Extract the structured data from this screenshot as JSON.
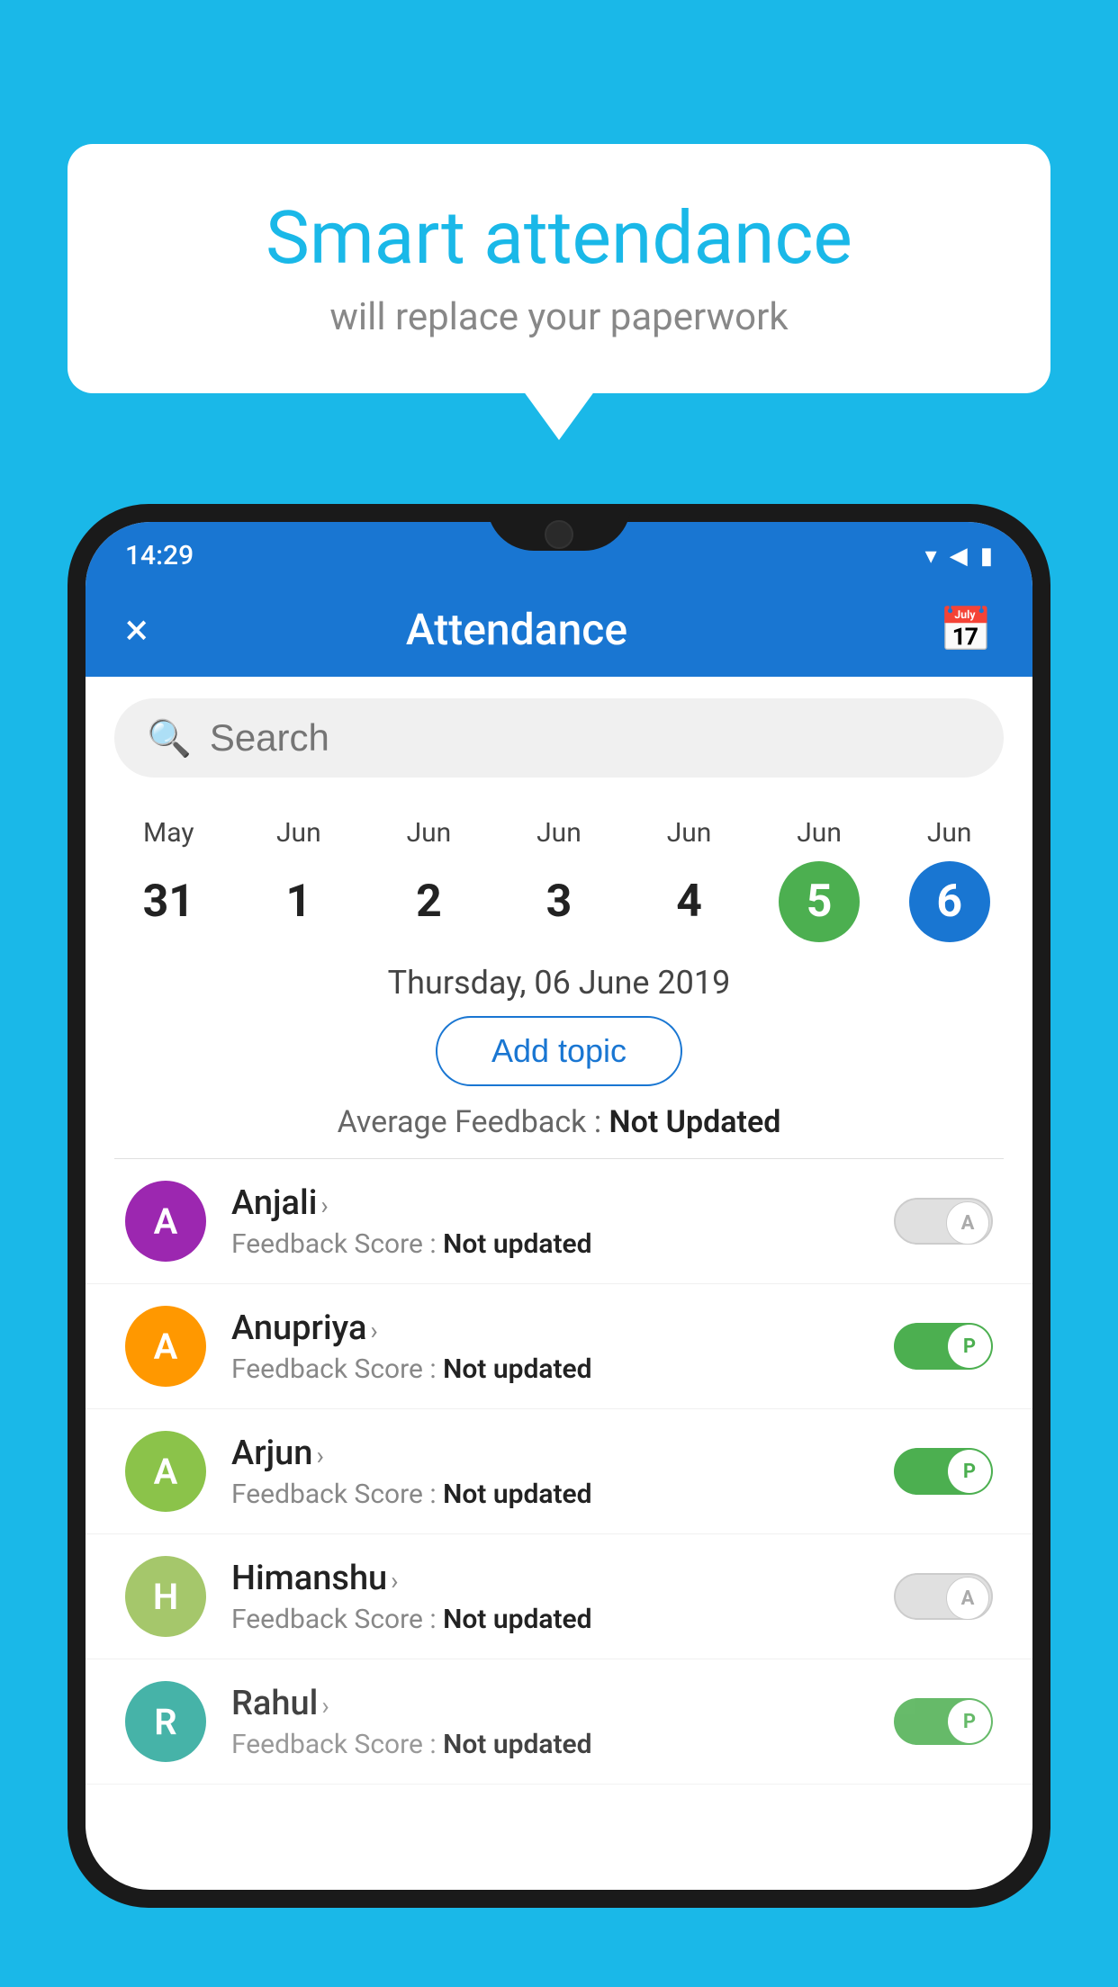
{
  "background_color": "#1ab8e8",
  "speech_bubble": {
    "title": "Smart attendance",
    "subtitle": "will replace your paperwork"
  },
  "status_bar": {
    "time": "14:29",
    "icons": [
      "wifi",
      "signal",
      "battery"
    ]
  },
  "app_bar": {
    "title": "Attendance",
    "close_label": "×",
    "calendar_icon": "📅"
  },
  "search": {
    "placeholder": "Search"
  },
  "calendar": {
    "days": [
      {
        "month": "May",
        "date": "31",
        "state": "normal"
      },
      {
        "month": "Jun",
        "date": "1",
        "state": "normal"
      },
      {
        "month": "Jun",
        "date": "2",
        "state": "normal"
      },
      {
        "month": "Jun",
        "date": "3",
        "state": "normal"
      },
      {
        "month": "Jun",
        "date": "4",
        "state": "normal"
      },
      {
        "month": "Jun",
        "date": "5",
        "state": "today"
      },
      {
        "month": "Jun",
        "date": "6",
        "state": "selected"
      }
    ]
  },
  "selected_date_label": "Thursday, 06 June 2019",
  "add_topic_label": "Add topic",
  "average_feedback_prefix": "Average Feedback : ",
  "average_feedback_value": "Not Updated",
  "students": [
    {
      "name": "Anjali",
      "initial": "A",
      "avatar_color": "#9c27b0",
      "feedback": "Not updated",
      "toggle_state": "off",
      "toggle_label": "A"
    },
    {
      "name": "Anupriya",
      "initial": "A",
      "avatar_color": "#ff9800",
      "feedback": "Not updated",
      "toggle_state": "on",
      "toggle_label": "P"
    },
    {
      "name": "Arjun",
      "initial": "A",
      "avatar_color": "#8bc34a",
      "feedback": "Not updated",
      "toggle_state": "on",
      "toggle_label": "P"
    },
    {
      "name": "Himanshu",
      "initial": "H",
      "avatar_color": "#a5c76b",
      "feedback": "Not updated",
      "toggle_state": "off",
      "toggle_label": "A"
    },
    {
      "name": "Rahul",
      "initial": "R",
      "avatar_color": "#26a69a",
      "feedback": "Not updated",
      "toggle_state": "on",
      "toggle_label": "P"
    }
  ],
  "feedback_score_prefix": "Feedback Score : "
}
